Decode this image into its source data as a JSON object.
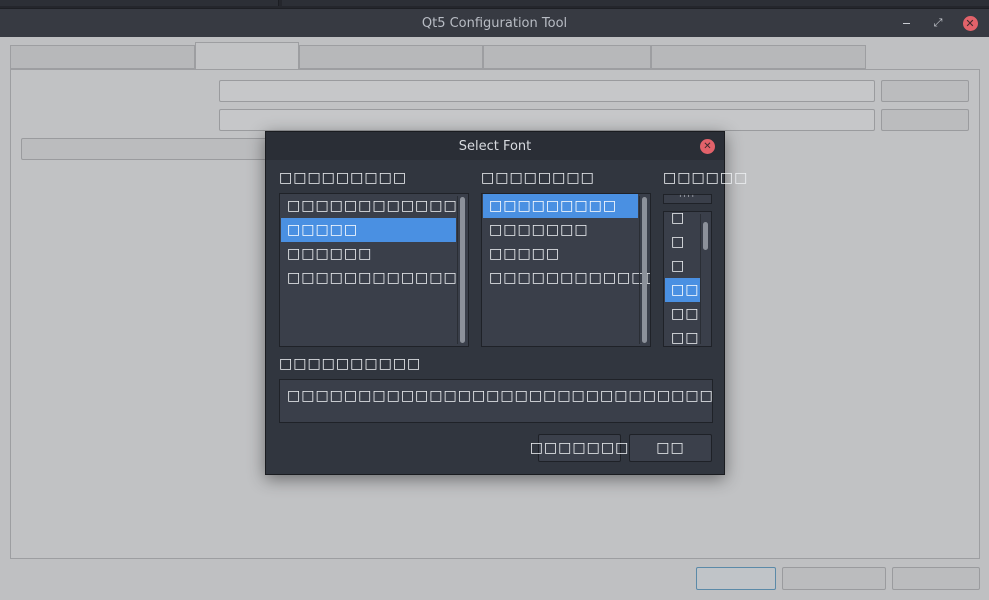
{
  "background_window": {
    "title": "Qt5 Configuration Tool"
  },
  "dialog": {
    "title": "Select Font",
    "family_label": "□□□□□□□□□",
    "style_label": "□□□□□□□□",
    "size_label": "□□□□□□",
    "families": [
      "□□□□□□□□□□□□",
      "□□□□□",
      "□□□□□□",
      "□□□□□□□□□□□□"
    ],
    "styles": [
      "□□□□□□□□□",
      "□□□□□□□",
      "□□□□□",
      "□□□□□□□□□□□□□□□□"
    ],
    "sizes": [
      "□",
      "□",
      "□",
      "□□",
      "□□",
      "□□",
      "□□"
    ],
    "spin_text": "ˈˈˈˈ",
    "sample_label": "□□□□□□□□□□",
    "sample_text": "□□□□□□□□□□□□□□□□□□□□□□□□□□□□□□□□",
    "cancel_label": "□□□□□□□",
    "ok_label": "□□",
    "selected_family_index": 1,
    "selected_style_index": 0,
    "selected_size_index": 3
  },
  "colors": {
    "accent": "#4a90e2",
    "close": "#e2626a",
    "dialog_bg": "#31363f"
  }
}
